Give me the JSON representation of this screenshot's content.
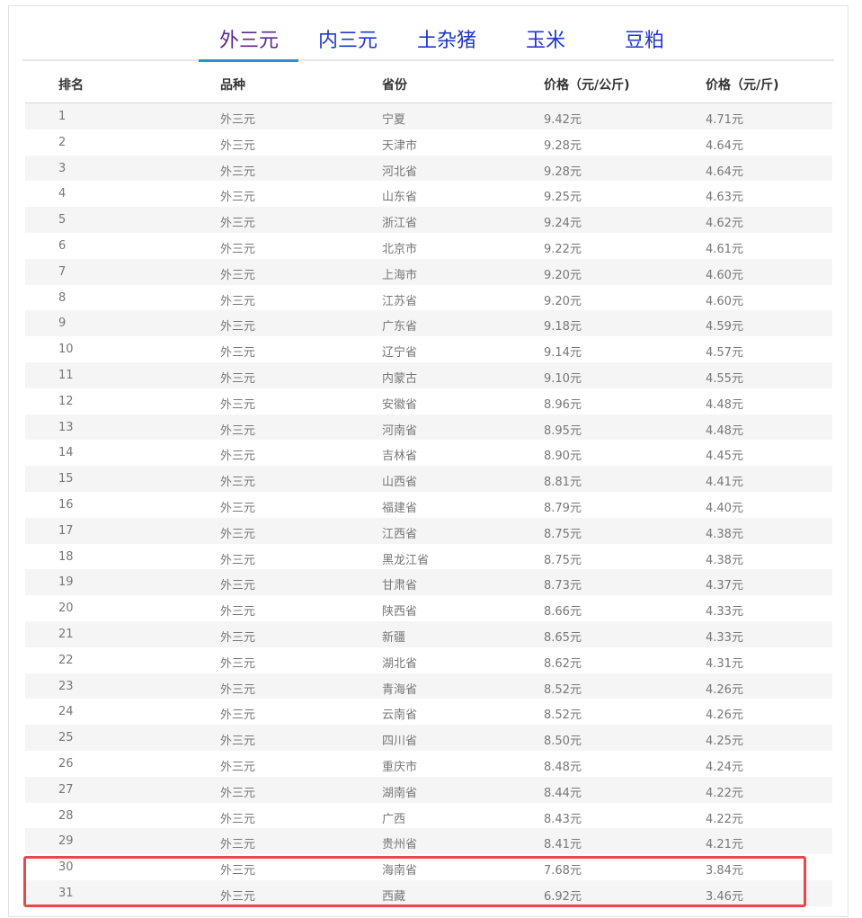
{
  "tabs": [
    {
      "label": "外三元",
      "active": true
    },
    {
      "label": "内三元",
      "active": false
    },
    {
      "label": "土杂猪",
      "active": false
    },
    {
      "label": "玉米",
      "active": false
    },
    {
      "label": "豆粕",
      "active": false
    }
  ],
  "table": {
    "headers": [
      "排名",
      "品种",
      "省份",
      "价格（元/公斤)",
      "价格（元/斤)"
    ],
    "rows": [
      [
        "1",
        "外三元",
        "宁夏",
        "9.42元",
        "4.71元"
      ],
      [
        "2",
        "外三元",
        "天津市",
        "9.28元",
        "4.64元"
      ],
      [
        "3",
        "外三元",
        "河北省",
        "9.28元",
        "4.64元"
      ],
      [
        "4",
        "外三元",
        "山东省",
        "9.25元",
        "4.63元"
      ],
      [
        "5",
        "外三元",
        "浙江省",
        "9.24元",
        "4.62元"
      ],
      [
        "6",
        "外三元",
        "北京市",
        "9.22元",
        "4.61元"
      ],
      [
        "7",
        "外三元",
        "上海市",
        "9.20元",
        "4.60元"
      ],
      [
        "8",
        "外三元",
        "江苏省",
        "9.20元",
        "4.60元"
      ],
      [
        "9",
        "外三元",
        "广东省",
        "9.18元",
        "4.59元"
      ],
      [
        "10",
        "外三元",
        "辽宁省",
        "9.14元",
        "4.57元"
      ],
      [
        "11",
        "外三元",
        "内蒙古",
        "9.10元",
        "4.55元"
      ],
      [
        "12",
        "外三元",
        "安徽省",
        "8.96元",
        "4.48元"
      ],
      [
        "13",
        "外三元",
        "河南省",
        "8.95元",
        "4.48元"
      ],
      [
        "14",
        "外三元",
        "吉林省",
        "8.90元",
        "4.45元"
      ],
      [
        "15",
        "外三元",
        "山西省",
        "8.81元",
        "4.41元"
      ],
      [
        "16",
        "外三元",
        "福建省",
        "8.79元",
        "4.40元"
      ],
      [
        "17",
        "外三元",
        "江西省",
        "8.75元",
        "4.38元"
      ],
      [
        "18",
        "外三元",
        "黑龙江省",
        "8.75元",
        "4.38元"
      ],
      [
        "19",
        "外三元",
        "甘肃省",
        "8.73元",
        "4.37元"
      ],
      [
        "20",
        "外三元",
        "陕西省",
        "8.66元",
        "4.33元"
      ],
      [
        "21",
        "外三元",
        "新疆",
        "8.65元",
        "4.33元"
      ],
      [
        "22",
        "外三元",
        "湖北省",
        "8.62元",
        "4.31元"
      ],
      [
        "23",
        "外三元",
        "青海省",
        "8.52元",
        "4.26元"
      ],
      [
        "24",
        "外三元",
        "云南省",
        "8.52元",
        "4.26元"
      ],
      [
        "25",
        "外三元",
        "四川省",
        "8.50元",
        "4.25元"
      ],
      [
        "26",
        "外三元",
        "重庆市",
        "8.48元",
        "4.24元"
      ],
      [
        "27",
        "外三元",
        "湖南省",
        "8.44元",
        "4.22元"
      ],
      [
        "28",
        "外三元",
        "广西",
        "8.43元",
        "4.22元"
      ],
      [
        "29",
        "外三元",
        "贵州省",
        "8.41元",
        "4.21元"
      ],
      [
        "30",
        "外三元",
        "海南省",
        "7.68元",
        "3.84元"
      ],
      [
        "31",
        "外三元",
        "西藏",
        "6.92元",
        "3.46元"
      ]
    ]
  },
  "highlight": {
    "rows": [
      30,
      31
    ],
    "color": "#e8474b"
  },
  "colors": {
    "tab_text": "#1f37c9",
    "tab_active_text": "#5a2a8c",
    "tab_underline": "#2a8fd6",
    "row_alt_bg": "#f5f5f5"
  }
}
